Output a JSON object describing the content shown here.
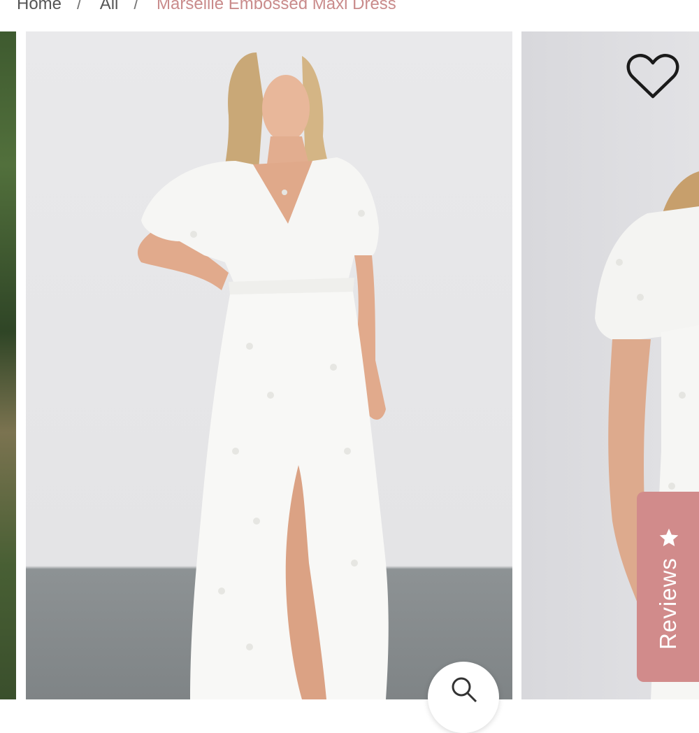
{
  "breadcrumb": {
    "items": [
      "Home",
      "All"
    ],
    "separator": "/",
    "current": "Marseille Embossed Maxi Dress"
  },
  "gallery": {
    "main_image_alt": "Marseille Embossed Maxi Dress",
    "next_image_alt": "Marseille Embossed Maxi Dress"
  },
  "actions": {
    "wishlist_icon": "heart-outline",
    "zoom_icon": "magnifier"
  },
  "reviews_tab": {
    "label": "Reviews",
    "icon": "star",
    "color": "#d18b8b"
  },
  "colors": {
    "accent": "#c98b8b",
    "text": "#555555"
  }
}
